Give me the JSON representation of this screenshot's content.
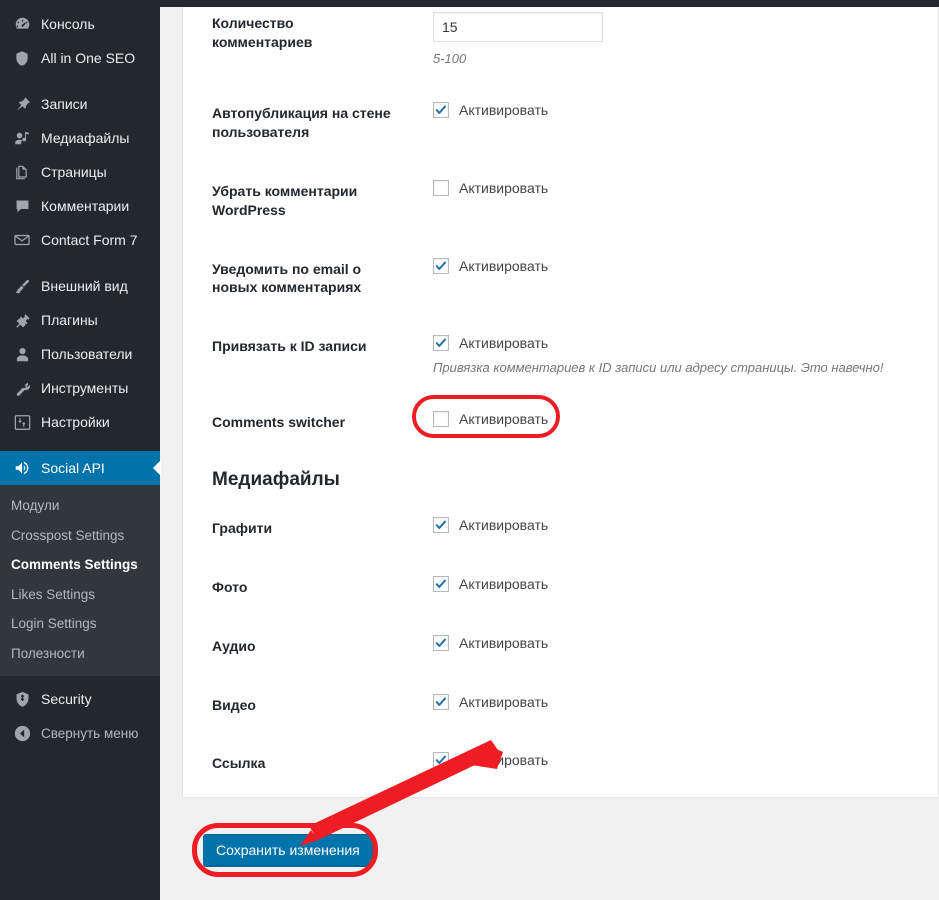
{
  "sidebar": {
    "top_items": [
      {
        "label": "Консоль",
        "icon": "dashboard-icon"
      },
      {
        "label": "All in One SEO",
        "icon": "shield-icon"
      }
    ],
    "content_items": [
      {
        "label": "Записи",
        "icon": "pin-icon"
      },
      {
        "label": "Медиафайлы",
        "icon": "media-icon"
      },
      {
        "label": "Страницы",
        "icon": "pages-icon"
      },
      {
        "label": "Комментарии",
        "icon": "comment-icon"
      },
      {
        "label": "Contact Form 7",
        "icon": "email-icon"
      }
    ],
    "admin_items": [
      {
        "label": "Внешний вид",
        "icon": "brush-icon"
      },
      {
        "label": "Плагины",
        "icon": "plugin-icon"
      },
      {
        "label": "Пользователи",
        "icon": "user-icon"
      },
      {
        "label": "Инструменты",
        "icon": "wrench-icon"
      },
      {
        "label": "Настройки",
        "icon": "settings-sliders-icon"
      }
    ],
    "active_item": {
      "label": "Social API",
      "icon": "megaphone-icon"
    },
    "submenu": [
      {
        "label": "Модули",
        "current": false
      },
      {
        "label": "Crosspost Settings",
        "current": false
      },
      {
        "label": "Comments Settings",
        "current": true
      },
      {
        "label": "Likes Settings",
        "current": false
      },
      {
        "label": "Login Settings",
        "current": false
      },
      {
        "label": "Полезности",
        "current": false
      }
    ],
    "security_item": {
      "label": "Security",
      "icon": "security-shield-icon"
    },
    "collapse_item": {
      "label": "Свернуть меню",
      "icon": "collapse-arrow-icon"
    },
    "colors": {
      "background": "#23282d",
      "submenu_background": "#32373c",
      "active_background": "#0073aa"
    }
  },
  "form": {
    "rows": [
      {
        "label": "Количество комментариев",
        "type": "text",
        "value": "15",
        "hint": "5-100"
      },
      {
        "label": "Автопубликация на стене пользователя",
        "type": "checkbox",
        "checkbox_label": "Активировать",
        "checked": true
      },
      {
        "label": "Убрать комментарии WordPress",
        "type": "checkbox",
        "checkbox_label": "Активировать",
        "checked": false
      },
      {
        "label": "Уведомить по email о новых комментариях",
        "type": "checkbox",
        "checkbox_label": "Активировать",
        "checked": true
      },
      {
        "label": "Привязать к ID записи",
        "type": "checkbox",
        "checkbox_label": "Активировать",
        "checked": true,
        "hint": "Привязка комментариев к ID записи или адресу страницы. Это навечно!"
      },
      {
        "label": "Comments switcher",
        "type": "checkbox",
        "checkbox_label": "Активировать",
        "checked": false,
        "highlighted": true
      }
    ],
    "section_heading": "Медиафайлы",
    "media_rows": [
      {
        "label": "Графити",
        "checkbox_label": "Активировать",
        "checked": true
      },
      {
        "label": "Фото",
        "checkbox_label": "Активировать",
        "checked": true
      },
      {
        "label": "Аудио",
        "checkbox_label": "Активировать",
        "checked": true
      },
      {
        "label": "Видео",
        "checkbox_label": "Активировать",
        "checked": true
      },
      {
        "label": "Ссылка",
        "checkbox_label": "Активировать",
        "checked": true
      }
    ],
    "submit_label": "Сохранить изменения"
  },
  "annotations": {
    "highlight_color": "#ee1d23",
    "arrow_color": "#ee1d23",
    "arrow_description": "red arrow pointing from media link row down-left to save button"
  }
}
